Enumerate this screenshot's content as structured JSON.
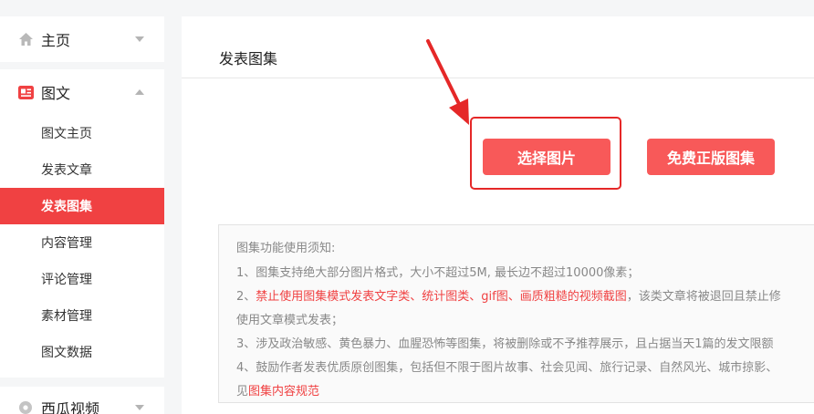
{
  "sidebar": {
    "home": {
      "label": "主页",
      "icon": "home-icon"
    },
    "graphic": {
      "label": "图文",
      "icon": "graphic-text-icon",
      "items": [
        {
          "label": "图文主页"
        },
        {
          "label": "发表文章"
        },
        {
          "label": "发表图集"
        },
        {
          "label": "内容管理"
        },
        {
          "label": "评论管理"
        },
        {
          "label": "素材管理"
        },
        {
          "label": "图文数据"
        }
      ],
      "active_index": 2
    },
    "video": {
      "label": "西瓜视频",
      "icon": "xigua-video-icon"
    }
  },
  "main": {
    "title": "发表图集",
    "buttons": {
      "select_image": "选择图片",
      "free_gallery": "免费正版图集"
    },
    "notice": {
      "heading": "图集功能使用须知:",
      "line1": "1、图集支持绝大部分图片格式，大小不超过5M, 最长边不超过10000像素；",
      "line2_prefix": "2、",
      "line2_red": "禁止使用图集模式发表文字类、统计图类、gif图、画质粗糙的视频截图",
      "line2_suffix": "，该类文章将被退回且禁止修",
      "line2_cont": "使用文章模式发表；",
      "line3": "3、涉及政治敏感、黄色暴力、血腥恐怖等图集，将被删除或不予推荐展示，且占据当天1篇的发文限额",
      "line4": "4、鼓励作者发表优质原创图集，包括但不限于图片故事、社会见闻、旅行记录、自然风光、城市掠影、",
      "line4_cont_prefix": "见",
      "line4_cont_link": "图集内容规范"
    }
  },
  "colors": {
    "accent": "#f04142",
    "button": "#f85959",
    "highlight": "#e52828"
  }
}
